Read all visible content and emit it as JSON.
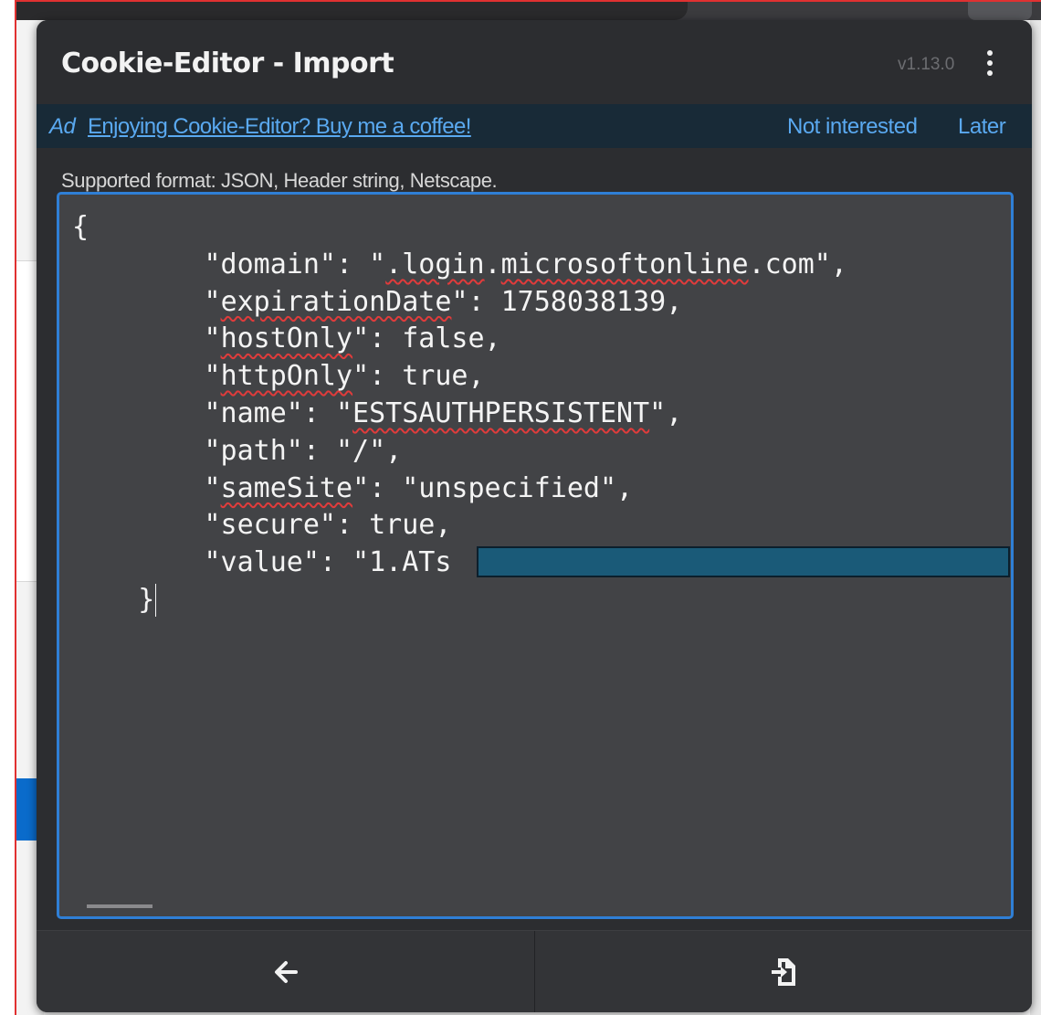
{
  "popup": {
    "title": "Cookie-Editor - Import",
    "version": "v1.13.0",
    "menu_icon": "more-vertical-icon"
  },
  "ad": {
    "tag": "Ad",
    "link_text": "Enjoying Cookie-Editor? Buy me a coffee!",
    "not_interested": "Not interested",
    "later": "Later",
    "color": "#5aa9f0"
  },
  "import": {
    "supported_format": "Supported format: JSON, Header string, Netscape.",
    "code_lines": [
      "{",
      "        \"domain\": \".login.microsoftonline.com\",",
      "        \"expirationDate\": 1758038139,",
      "        \"hostOnly\": false,",
      "        \"httpOnly\": true,",
      "        \"name\": \"ESTSAUTHPERSISTENT\",",
      "        \"path\": \"/\",",
      "        \"sameSite\": \"unspecified\",",
      "        \"secure\": true,",
      "        \"value\": \"1.ATs",
      "    }"
    ],
    "accent_border": "#2f7fd6",
    "redaction_color": "#1a5a78"
  },
  "footer": {
    "back_icon": "arrow-left-icon",
    "import_icon": "file-import-icon"
  }
}
